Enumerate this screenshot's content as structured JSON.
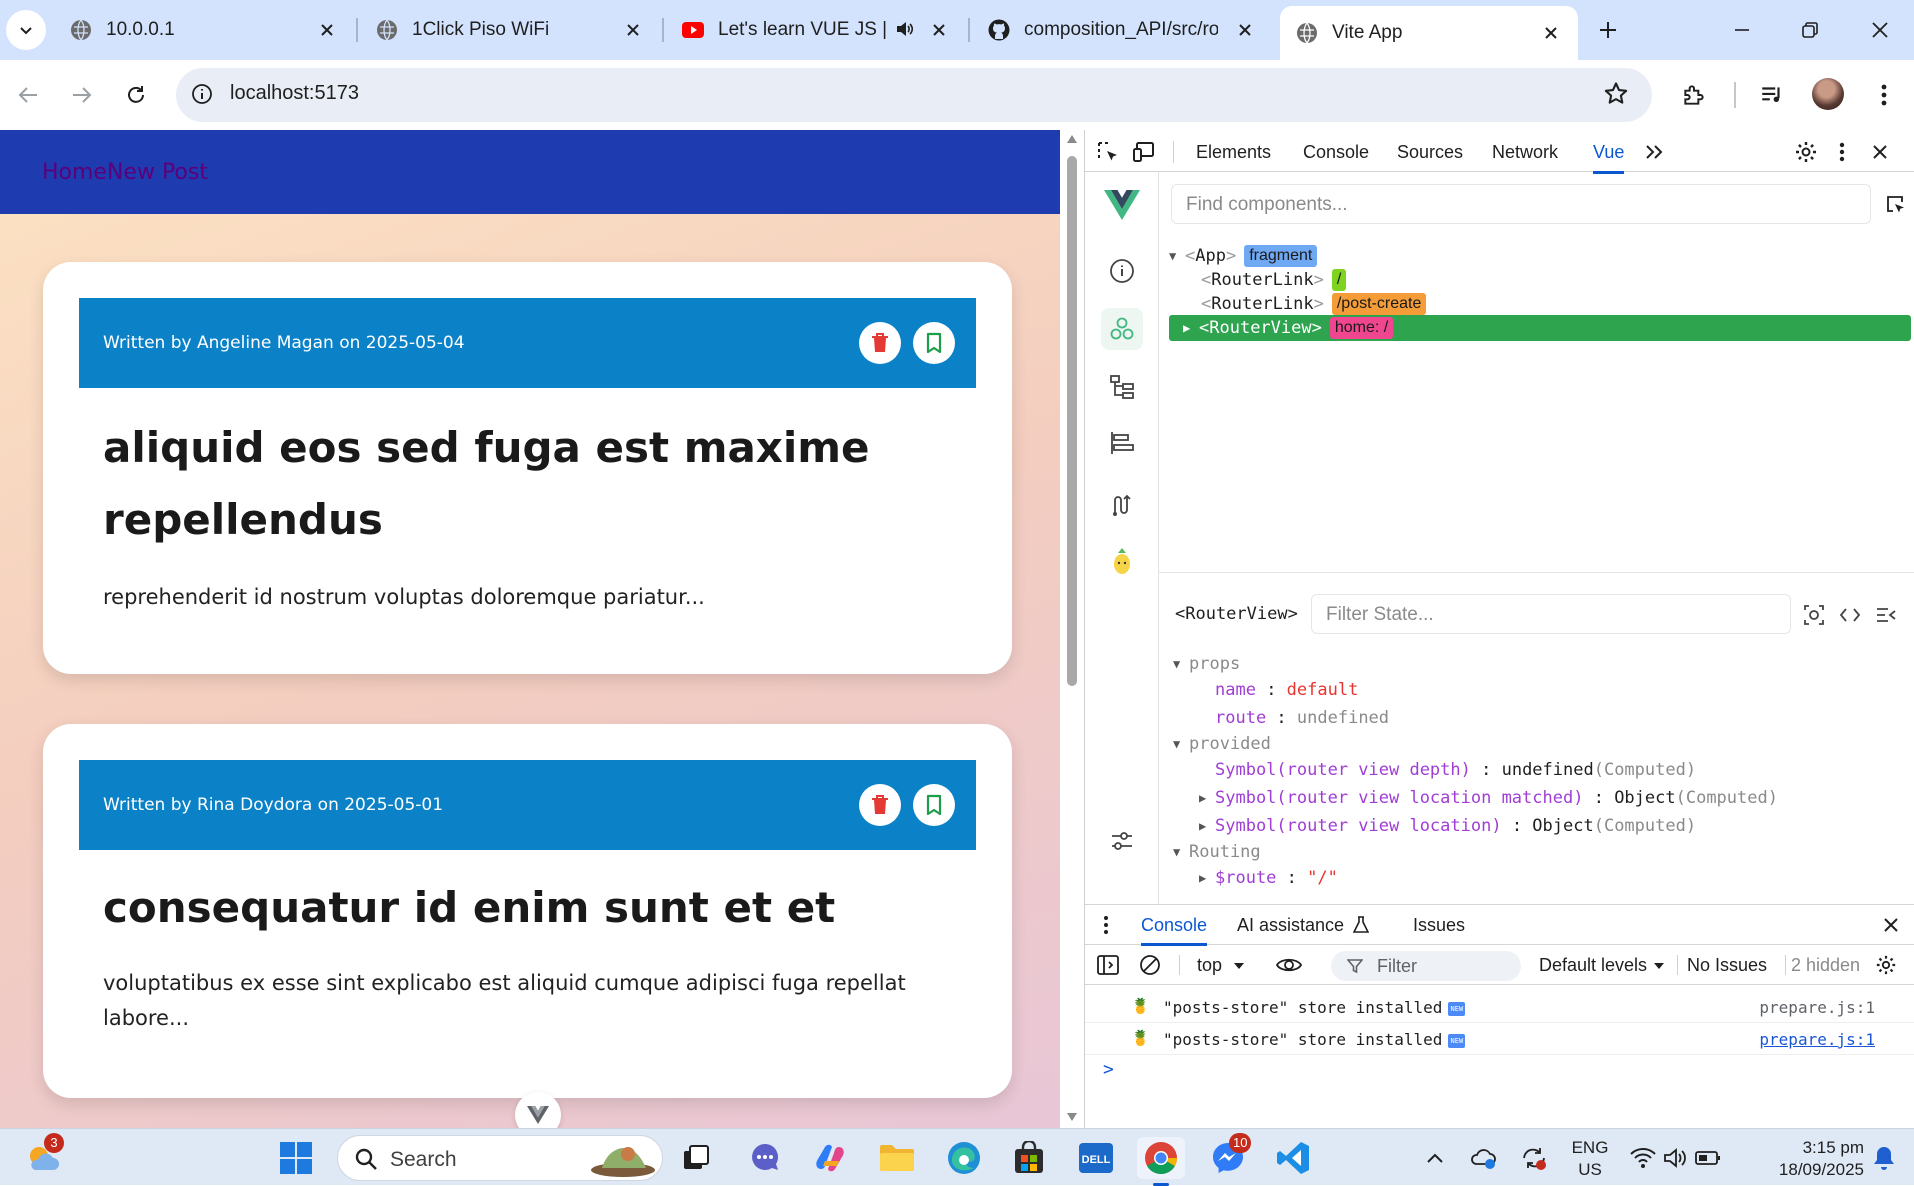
{
  "browser": {
    "tabs": [
      {
        "title": "10.0.0.1",
        "favicon": "globe-icon"
      },
      {
        "title": "1Click Piso WiFi",
        "favicon": "globe-icon"
      },
      {
        "title": "Let's learn VUE JS | Co",
        "favicon": "youtube-icon",
        "audio": true
      },
      {
        "title": "composition_API/src/rout",
        "favicon": "github-icon"
      },
      {
        "title": "Vite App",
        "favicon": "globe-icon",
        "active": true
      }
    ],
    "url": "localhost:5173"
  },
  "site": {
    "nav": {
      "home": "Home",
      "new_post": "New Post"
    },
    "posts": [
      {
        "meta": "Written by Angeline Magan on 2025-05-04",
        "title": "aliquid eos sed fuga est maxime repellendus",
        "excerpt": "reprehenderit id nostrum voluptas doloremque pariatur..."
      },
      {
        "meta": "Written by Rina Doydora on 2025-05-01",
        "title": "consequatur id enim sunt et et",
        "excerpt": "voluptatibus ex esse sint explicabo est aliquid cumque adipisci fuga repellat labore..."
      }
    ]
  },
  "devtools": {
    "tabs": [
      "Elements",
      "Console",
      "Sources",
      "Network",
      "Vue"
    ],
    "active_tab": "Vue",
    "find_placeholder": "Find components...",
    "tree": {
      "app": {
        "name": "App",
        "tag": "fragment"
      },
      "link1": {
        "name": "RouterLink",
        "tag": "/"
      },
      "link2": {
        "name": "RouterLink",
        "tag": "/post-create"
      },
      "view": {
        "name": "RouterView",
        "tag": "home: /"
      }
    },
    "inspector": {
      "component": "<RouterView>",
      "filter_placeholder": "Filter State...",
      "props_label": "props",
      "name_key": "name",
      "name_val": "default",
      "route_key": "route",
      "route_val": "undefined",
      "provided_label": "provided",
      "p1_key": "Symbol(router view depth)",
      "p1_val": "undefined",
      "p2_key": "Symbol(router view location matched)",
      "p2_val": "Object",
      "p3_key": "Symbol(router view location)",
      "p3_val": "Object",
      "computed": "(Computed)",
      "routing_label": "Routing",
      "route_obj_key": "$route",
      "route_obj_val": "\"/\""
    },
    "console": {
      "tabs": [
        "Console",
        "AI assistance",
        "Issues"
      ],
      "context": "top",
      "filter": "Filter",
      "levels": "Default levels",
      "issues": "No Issues",
      "hidden": "2 hidden",
      "logs": [
        {
          "msg": "\"posts-store\" store installed",
          "src": "prepare.js:1"
        },
        {
          "msg": "\"posts-store\" store installed",
          "src": "prepare.js:1"
        }
      ],
      "prompt": ">"
    }
  },
  "taskbar": {
    "search": "Search",
    "weather_badge": "3",
    "messenger_badge": "10",
    "lang1": "ENG",
    "lang2": "US",
    "time": "3:15 pm",
    "date": "18/09/2025"
  },
  "colors": {
    "accent": "#0b57d0",
    "nav": "#1f3bb0",
    "card_header": "#0b82c8",
    "selected": "#2ea44f"
  }
}
